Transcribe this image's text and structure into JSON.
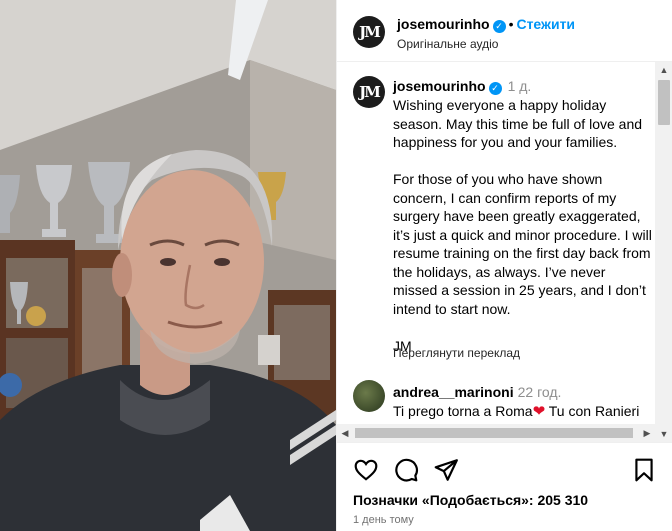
{
  "header": {
    "avatar_text": "JM",
    "username": "josemourinho",
    "separator": "•",
    "follow_label": "Стежити",
    "audio_label": "Оригінальне аудіо"
  },
  "caption": {
    "username": "josemourinho",
    "time": "1 д.",
    "text": "Wishing everyone a happy holiday season. May this time be full of love and happiness for you and your families.\n\nFor those of you who have shown concern, I can confirm reports of my surgery have been greatly exaggerated, it’s just a quick and minor procedure. I will resume training on the first day back from the holidays, as always. I’ve never missed a session in 25 years, and I don’t intend to start now.\n\nJM",
    "translate_label": "Переглянути переклад"
  },
  "comment": {
    "username": "andrea__marinoni",
    "time": "22 год.",
    "text_before_heart": "Ti prego torna a Roma",
    "heart": "❤",
    "text_after_heart": " Tu con Ranieri dirigente potete fare"
  },
  "actions": {
    "likes_text": "Позначки «Подобається»: 205 310",
    "date": "1 день тому"
  },
  "icons": {
    "like": "heart-outline-icon",
    "comment": "speech-bubble-icon",
    "share": "paper-plane-icon",
    "save": "bookmark-icon",
    "verified": "verified-badge-icon"
  },
  "colors": {
    "link_blue": "#0095f6",
    "muted_text": "#8e8e8e",
    "heart_red": "#e0102a"
  }
}
